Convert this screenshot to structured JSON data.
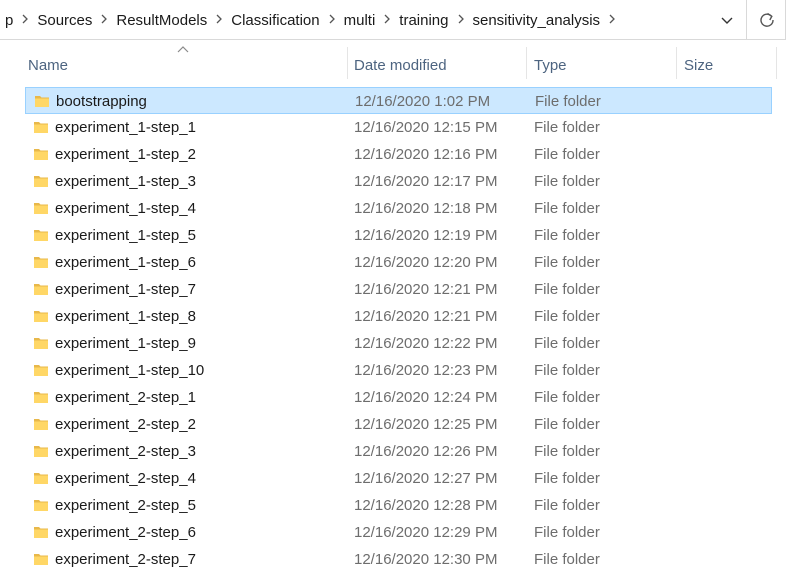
{
  "breadcrumb": {
    "items": [
      "p",
      "Sources",
      "ResultModels",
      "Classification",
      "multi",
      "training",
      "sensitivity_analysis"
    ]
  },
  "icons": {
    "separator": "chevron-right-icon",
    "dropdown": "chevron-down-icon",
    "refresh": "refresh-icon",
    "folder": "folder-icon",
    "sort": "sort-ascending-icon"
  },
  "colors": {
    "selection_bg": "#cce8ff",
    "selection_border": "#99d1ff",
    "header_text": "#4d6480",
    "folder_yellow": "#ffd766"
  },
  "columns": {
    "name": "Name",
    "date": "Date modified",
    "type": "Type",
    "size": "Size"
  },
  "files": [
    {
      "name": "bootstrapping",
      "date": "12/16/2020 1:02 PM",
      "type": "File folder",
      "selected": true
    },
    {
      "name": "experiment_1-step_1",
      "date": "12/16/2020 12:15 PM",
      "type": "File folder"
    },
    {
      "name": "experiment_1-step_2",
      "date": "12/16/2020 12:16 PM",
      "type": "File folder"
    },
    {
      "name": "experiment_1-step_3",
      "date": "12/16/2020 12:17 PM",
      "type": "File folder"
    },
    {
      "name": "experiment_1-step_4",
      "date": "12/16/2020 12:18 PM",
      "type": "File folder"
    },
    {
      "name": "experiment_1-step_5",
      "date": "12/16/2020 12:19 PM",
      "type": "File folder"
    },
    {
      "name": "experiment_1-step_6",
      "date": "12/16/2020 12:20 PM",
      "type": "File folder"
    },
    {
      "name": "experiment_1-step_7",
      "date": "12/16/2020 12:21 PM",
      "type": "File folder"
    },
    {
      "name": "experiment_1-step_8",
      "date": "12/16/2020 12:21 PM",
      "type": "File folder"
    },
    {
      "name": "experiment_1-step_9",
      "date": "12/16/2020 12:22 PM",
      "type": "File folder"
    },
    {
      "name": "experiment_1-step_10",
      "date": "12/16/2020 12:23 PM",
      "type": "File folder"
    },
    {
      "name": "experiment_2-step_1",
      "date": "12/16/2020 12:24 PM",
      "type": "File folder"
    },
    {
      "name": "experiment_2-step_2",
      "date": "12/16/2020 12:25 PM",
      "type": "File folder"
    },
    {
      "name": "experiment_2-step_3",
      "date": "12/16/2020 12:26 PM",
      "type": "File folder"
    },
    {
      "name": "experiment_2-step_4",
      "date": "12/16/2020 12:27 PM",
      "type": "File folder"
    },
    {
      "name": "experiment_2-step_5",
      "date": "12/16/2020 12:28 PM",
      "type": "File folder"
    },
    {
      "name": "experiment_2-step_6",
      "date": "12/16/2020 12:29 PM",
      "type": "File folder"
    },
    {
      "name": "experiment_2-step_7",
      "date": "12/16/2020 12:30 PM",
      "type": "File folder"
    }
  ]
}
